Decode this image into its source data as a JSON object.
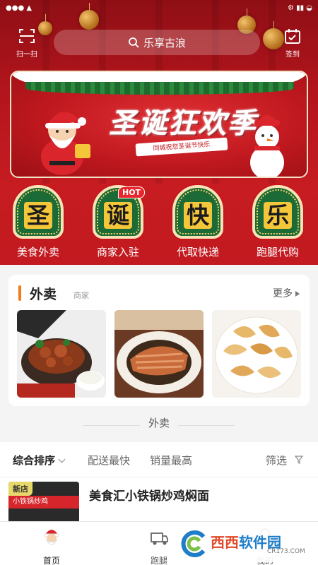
{
  "colors": {
    "brand_red": "#c61c22",
    "accent_orange": "#f07d1c",
    "green": "#1c6a35",
    "gold": "#f4c63a"
  },
  "header": {
    "scan_label": "扫一扫",
    "sign_label": "签到",
    "search_placeholder": "乐享古浪"
  },
  "banner": {
    "title": "圣诞狂欢季",
    "ribbon": "同城祝您圣诞节快乐"
  },
  "categories": [
    {
      "glyph": "圣",
      "label": "美食外卖",
      "icon": "santa-frame-icon"
    },
    {
      "glyph": "诞",
      "label": "商家入驻",
      "icon": "santa-frame-icon",
      "badge": "HOT"
    },
    {
      "glyph": "快",
      "label": "代取快递",
      "icon": "santa-frame-icon"
    },
    {
      "glyph": "乐",
      "label": "跑腿代购",
      "icon": "santa-frame-icon"
    }
  ],
  "takeaway": {
    "title": "外卖",
    "subtitle": "商家",
    "more": "更多"
  },
  "section_label": "外卖",
  "sort": {
    "items": [
      "综合排序",
      "配送最快",
      "销量最高"
    ],
    "filter": "筛选"
  },
  "shops": [
    {
      "badge": "新店",
      "sign": "小铁锅炒鸡",
      "name": "美食汇小铁锅炒鸡焖面"
    }
  ],
  "tabs": [
    {
      "label": "首页",
      "icon": "santa-home-icon"
    },
    {
      "label": "跑腿",
      "icon": "delivery-cart-icon"
    },
    {
      "label": "",
      "icon": "orders-icon"
    },
    {
      "label": "我的",
      "icon": "user-icon"
    }
  ],
  "watermark": {
    "name_a": "西西",
    "name_b": "软件园",
    "domain": "CR173.COM"
  }
}
